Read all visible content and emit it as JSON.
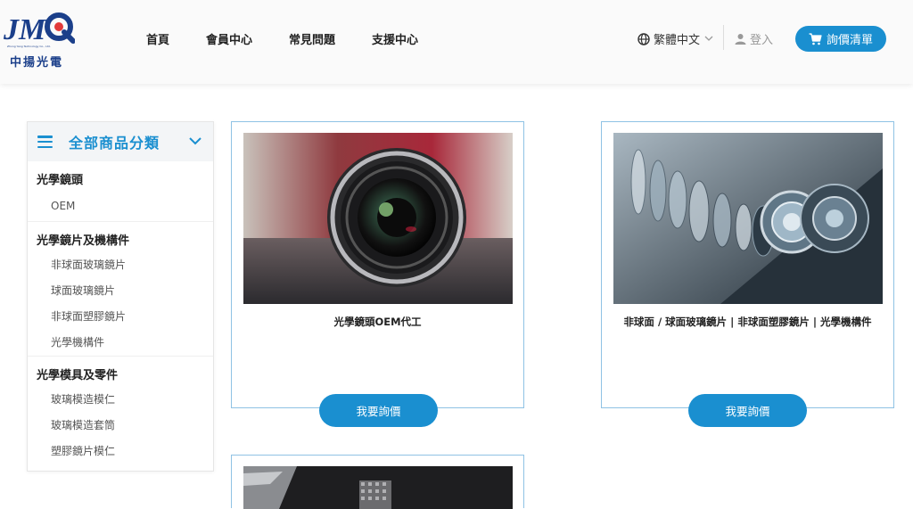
{
  "brand": {
    "logo_text": "JMQ",
    "logo_subtext": "Zhong Yang Technology Co., Ltd.",
    "name_cn": "中揚光電",
    "color": "#1b3f8a"
  },
  "nav": {
    "items": [
      {
        "label": "首頁"
      },
      {
        "label": "會員中心"
      },
      {
        "label": "常見問題"
      },
      {
        "label": "支援中心"
      }
    ]
  },
  "header": {
    "language": "繁體中文",
    "login": "登入",
    "quote_list": "詢價清單",
    "accent": "#1a8fd0"
  },
  "sidebar": {
    "title": "全部商品分類",
    "groups": [
      {
        "label": "光學鏡頭",
        "items": [
          {
            "label": "OEM"
          }
        ]
      },
      {
        "label": "光學鏡片及機構件",
        "items": [
          {
            "label": "非球面玻璃鏡片"
          },
          {
            "label": "球面玻璃鏡片"
          },
          {
            "label": "非球面塑膠鏡片"
          },
          {
            "label": "光學機構件"
          }
        ]
      },
      {
        "label": "光學模具及零件",
        "items": [
          {
            "label": "玻璃模造模仁"
          },
          {
            "label": "玻璃模造套筒"
          },
          {
            "label": "塑膠鏡片模仁"
          }
        ]
      }
    ]
  },
  "products": [
    {
      "title": "光學鏡頭OEM代工",
      "button": "我要詢價",
      "image": "camera-lens-photo"
    },
    {
      "title": "非球面 / 球面玻璃鏡片 | 非球面塑膠鏡片 | 光學機構件",
      "button": "我要詢價",
      "image": "exploded-lens-photo"
    },
    {
      "title": "",
      "button": "",
      "image": "mold-parts-photo"
    }
  ]
}
